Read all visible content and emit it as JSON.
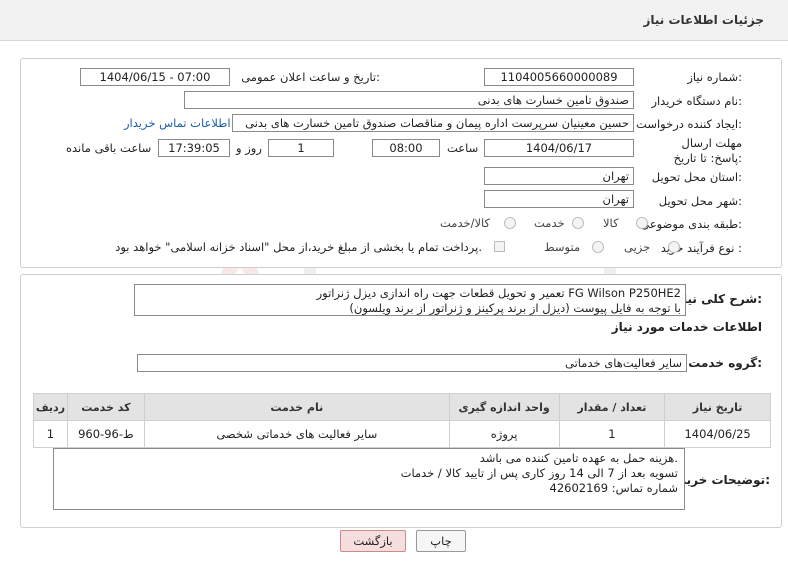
{
  "header": {
    "title": "جزئیات اطلاعات نیاز"
  },
  "form": {
    "need_number_label": "شماره نیاز:",
    "need_number": "1104005660000089",
    "announce_label": "تاریخ و ساعت اعلان عمومی:",
    "announce_value": "1404/06/15 - 07:00",
    "buyer_org_label": "نام دستگاه خریدار:",
    "buyer_org": "صندوق تامین خسارت های بدنی",
    "creator_label": "ایجاد کننده درخواست:",
    "creator": "حسین  معینیان سرپرست اداره پیمان و مناقصات صندوق تامین خسارت های بدنی",
    "contact_link": "اطلاعات تماس خریدار",
    "deadline_label": "مهلت ارسال پاسخ: تا تاریخ:",
    "deadline_date": "1404/06/17",
    "time_label": "ساعت",
    "deadline_time": "08:00",
    "days": "1",
    "days_label": "روز و",
    "remaining_time": "17:39:05",
    "remaining_label": "ساعت باقی مانده",
    "province_label": "استان محل تحویل:",
    "province": "تهران",
    "city_label": "شهر محل تحویل:",
    "city": "تهران",
    "category_label": "طبقه بندی موضوعی:",
    "category_options": [
      "کالا",
      "خدمت",
      "کالا/خدمت"
    ],
    "process_label": "نوع فرآیند خرید :",
    "process_options": [
      "جزیی",
      "متوسط"
    ],
    "payment_note": "پرداخت تمام یا بخشی از مبلغ خرید،از محل \"اسناد خزانه اسلامی\" خواهد بود."
  },
  "summary": {
    "label": "شرح کلی نیاز:",
    "line1": "تعمیر و تحویل قطعات جهت راه اندازی دیزل ژنراتور FG Wilson P250HE2",
    "line2": "با توجه به فایل پیوست (دیزل از برند پرکینز و ژنراتور از برند ویلسون)"
  },
  "services": {
    "section_title": "اطلاعات خدمات مورد نیاز",
    "group_label": "گروه خدمت:",
    "group_value": "سایر فعالیت‌های خدماتی",
    "columns": [
      "ردیف",
      "کد خدمت",
      "نام خدمت",
      "واحد اندازه گیری",
      "تعداد / مقدار",
      "تاریخ نیاز"
    ],
    "rows": [
      [
        "1",
        "ط-96-960",
        "سایر فعالیت های خدماتی شخصی",
        "پروژه",
        "1",
        "1404/06/25"
      ]
    ]
  },
  "buyer_notes": {
    "label": "توضیحات خریدار:",
    "line1": "هزینه حمل به عهده تامین کننده می باشد.",
    "line2": "تسویه بعد از 7 الی 14 روز کاری پس از تایید کالا / خدمات",
    "line3": "شماره تماس: 42602169"
  },
  "buttons": {
    "print": "چاپ",
    "back": "بازگشت"
  },
  "colors": {
    "link": "#1a5fa8",
    "back_button": "#f7dede"
  }
}
